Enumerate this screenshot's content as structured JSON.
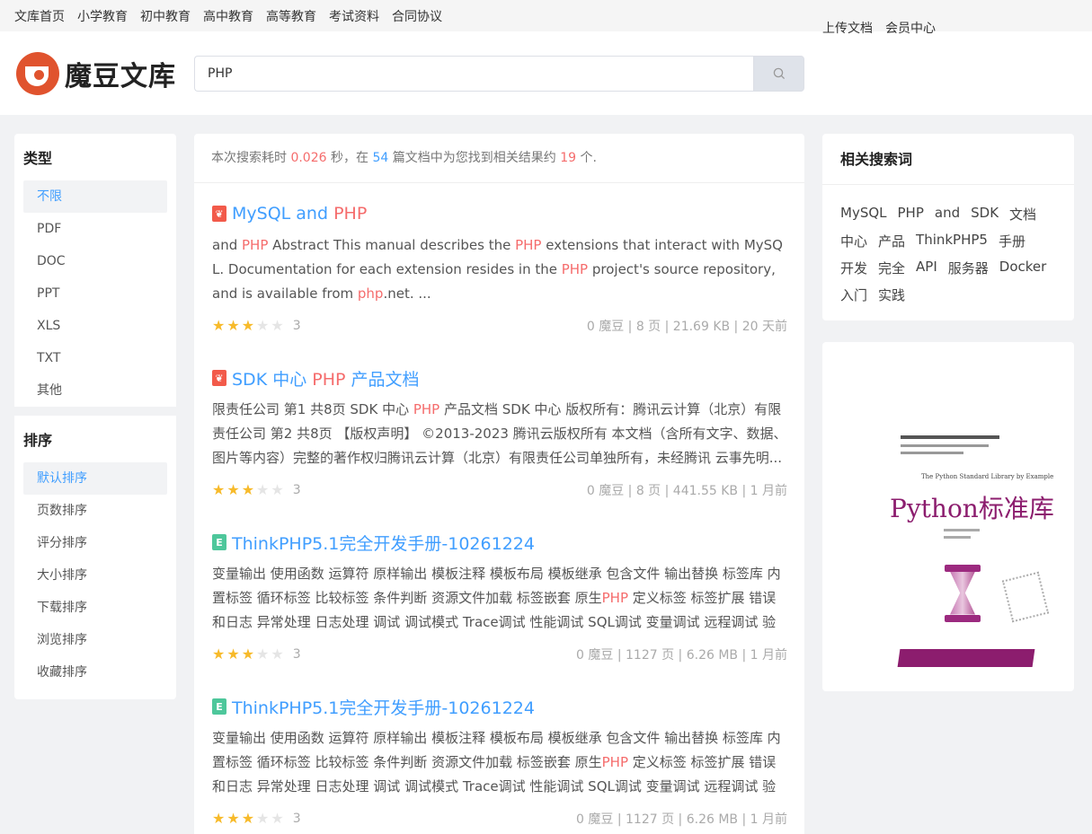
{
  "topnav": {
    "left": [
      "文库首页",
      "小学教育",
      "初中教育",
      "高中教育",
      "高等教育",
      "考试资料",
      "合同协议"
    ],
    "right": [
      "上传文档",
      "会员中心"
    ]
  },
  "logo": {
    "text": "魔豆文库"
  },
  "search": {
    "value": "PHP",
    "button_icon": "search-icon"
  },
  "sidebar": {
    "type_title": "类型",
    "types": [
      "不限",
      "PDF",
      "DOC",
      "PPT",
      "XLS",
      "TXT",
      "其他"
    ],
    "sort_title": "排序",
    "sorts": [
      "默认排序",
      "页数排序",
      "评分排序",
      "大小排序",
      "下载排序",
      "浏览排序",
      "收藏排序"
    ]
  },
  "summary": {
    "p1": "本次搜索耗时 ",
    "time": "0.026",
    "p2": " 秒，在 ",
    "docs": "54",
    "p3": " 篇文档中为您找到相关结果约 ",
    "count": "19",
    "p4": " 个."
  },
  "results": [
    {
      "icon": "pdf-icon",
      "title_parts": [
        {
          "t": "MySQL and "
        },
        {
          "t": "PHP",
          "hl": true
        }
      ],
      "desc_parts": [
        {
          "t": "and "
        },
        {
          "t": "PHP",
          "hl": true
        },
        {
          "t": " Abstract This manual describes the "
        },
        {
          "t": "PHP",
          "hl": true
        },
        {
          "t": " extensions that interact with MySQL. Documentation for each extension resides in the "
        },
        {
          "t": "PHP",
          "hl": true
        },
        {
          "t": " project's source repository, and is available from "
        },
        {
          "t": "php",
          "hl": true
        },
        {
          "t": ".net. ..."
        }
      ],
      "rating": 3,
      "score": "3",
      "meta": "0 魔豆 | 8 页 | 21.69 KB | 20 天前"
    },
    {
      "icon": "pdf-icon",
      "title_parts": [
        {
          "t": "SDK 中心 "
        },
        {
          "t": "PHP",
          "hl": true
        },
        {
          "t": " 产品文档"
        }
      ],
      "desc_parts": [
        {
          "t": "限责任公司 第1 共8页 SDK 中心 "
        },
        {
          "t": "PHP",
          "hl": true
        },
        {
          "t": " 产品文档 SDK 中心 版权所有：腾讯云计算（北京）有限责任公司 第2 共8页 【版权声明】 ©2013-2023 腾讯云版权所有 本文档（含所有文字、数据、图片等内容）完整的著作权归腾讯云计算（北京）有限责任公司单独所有，未经腾讯 云事先明..."
        }
      ],
      "rating": 3,
      "score": "3",
      "meta": "0 魔豆 | 8 页 | 441.55 KB | 1 月前"
    },
    {
      "icon": "epub-icon",
      "title_parts": [
        {
          "t": "ThinkPHP5.1完全开发手册-10261224"
        }
      ],
      "desc_parts": [
        {
          "t": "变量输出 使用函数 运算符 原样输出 模板注释 模板布局 模板继承 包含文件 输出替换 标签库 内置标签 循环标签 比较标签 条件判断 资源文件加载 标签嵌套 原生"
        },
        {
          "t": "PHP",
          "hl": true
        },
        {
          "t": " 定义标签 标签扩展 错误和日志 异常处理 日志处理 调试 调试模式 Trace调试 性能调试 SQL调试 变量调试 远程调试 验证 ..."
        }
      ],
      "rating": 3,
      "score": "3",
      "meta": "0 魔豆 | 1127 页 | 6.26 MB | 1 月前"
    },
    {
      "icon": "epub-icon",
      "title_parts": [
        {
          "t": "ThinkPHP5.1完全开发手册-10261224"
        }
      ],
      "desc_parts": [
        {
          "t": "变量输出 使用函数 运算符 原样输出 模板注释 模板布局 模板继承 包含文件 输出替换 标签库 内置标签 循环标签 比较标签 条件判断 资源文件加载 标签嵌套 原生"
        },
        {
          "t": "PHP",
          "hl": true
        },
        {
          "t": " 定义标签 标签扩展 错误和日志 异常处理 日志处理 调试 调试模式 Trace调试 性能调试 SQL调试 变量调试 远程调试 验证 ..."
        }
      ],
      "rating": 3,
      "score": "3",
      "meta": "0 魔豆 | 1127 页 | 6.26 MB | 1 月前"
    }
  ],
  "related": {
    "title": "相关搜索词",
    "tags": [
      "MySQL",
      "PHP",
      "and",
      "SDK",
      "文档",
      "中心",
      "产品",
      "ThinkPHP5",
      "手册",
      "开发",
      "完全",
      "API",
      "服务器",
      "Docker",
      "入门",
      "实践"
    ]
  },
  "book": {
    "title": "Python标准库",
    "subtitle_en": "The Python Standard Library by Example"
  },
  "colors": {
    "link": "#409eff",
    "highlight": "#f56c6c",
    "star": "#f7ba2a",
    "logo": "#e0532e"
  }
}
